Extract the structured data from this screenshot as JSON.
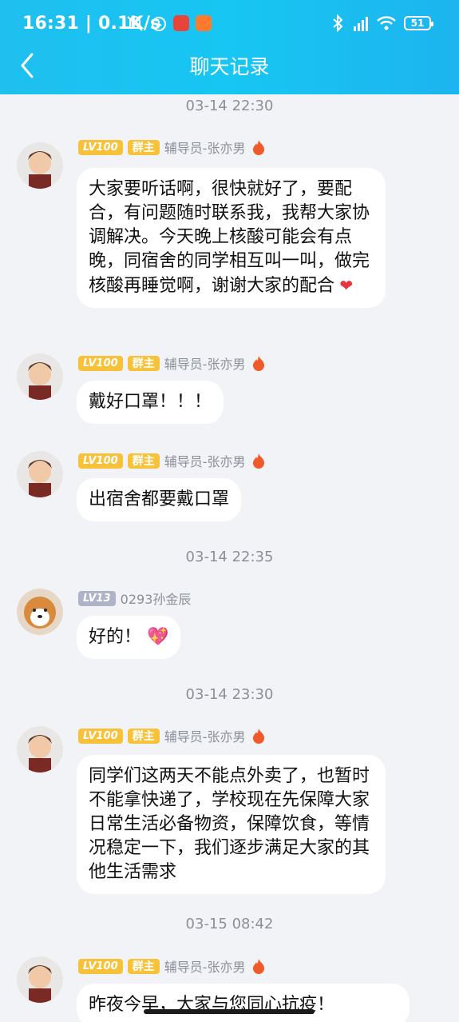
{
  "status_bar": {
    "time": "16:31",
    "speed": "0.1K/s",
    "battery": "51",
    "signal_label": "HD"
  },
  "header": {
    "title": "聊天记录"
  },
  "messages": [
    {
      "timestamp": "03-14 22:30",
      "level": "LV100",
      "role": "群主",
      "name": "辅导员-张亦男",
      "text": "大家要听话啊，很快就好了，要配合，有问题随时联系我，我帮大家协调解决。今天晚上核酸可能会有点晚，同宿舍的同学相互叫一叫，做完核酸再睡觉啊，谢谢大家的配合"
    },
    {
      "level": "LV100",
      "role": "群主",
      "name": "辅导员-张亦男",
      "text": "戴好口罩！！！"
    },
    {
      "level": "LV100",
      "role": "群主",
      "name": "辅导员-张亦男",
      "text": "出宿舍都要戴口罩"
    },
    {
      "timestamp": "03-14 22:35",
      "level": "LV13",
      "name": "0293孙金辰",
      "text": "好的！"
    },
    {
      "timestamp": "03-14 23:30",
      "level": "LV100",
      "role": "群主",
      "name": "辅导员-张亦男",
      "text": "同学们这两天不能点外卖了，也暂时不能拿快递了，学校现在先保障大家日常生活必备物资，保障饮食，等情况稳定一下，我们逐步满足大家的其他生活需求"
    },
    {
      "timestamp": "03-15 08:42",
      "level": "LV100",
      "role": "群主",
      "name": "辅导员-张亦男",
      "text": "昨夜今早，大家与您同心抗疫！"
    }
  ]
}
